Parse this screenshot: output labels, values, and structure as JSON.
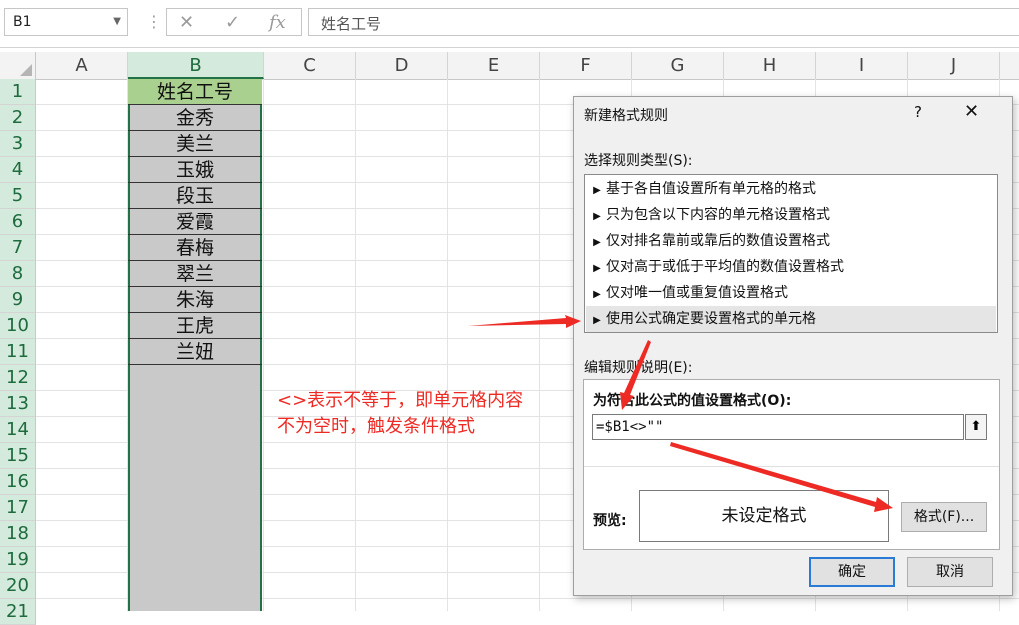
{
  "formula_bar": {
    "name_box": "B1",
    "cancel_icon": "✕",
    "enter_icon": "✓",
    "fx_icon": "fx",
    "content": "姓名工号"
  },
  "columns": [
    "A",
    "B",
    "C",
    "D",
    "E",
    "F",
    "G",
    "H",
    "I",
    "J"
  ],
  "rows": [
    "1",
    "2",
    "3",
    "4",
    "5",
    "6",
    "7",
    "8",
    "9",
    "10",
    "11",
    "12",
    "13",
    "14",
    "15",
    "16",
    "17",
    "18",
    "19",
    "20",
    "21"
  ],
  "cells_B": [
    "姓名工号",
    "金秀",
    "美兰",
    "玉娥",
    "段玉",
    "爱霞",
    "春梅",
    "翠兰",
    "朱海",
    "王虎",
    "兰妞"
  ],
  "annotation": {
    "line1": "<>表示不等于，即单元格内容",
    "line2": "不为空时，触发条件格式"
  },
  "dialog": {
    "title": "新建格式规则",
    "help": "?",
    "close": "✕",
    "rule_type_label": "选择规则类型(S):",
    "rule_types": [
      "基于各自值设置所有单元格的格式",
      "只为包含以下内容的单元格设置格式",
      "仅对排名靠前或靠后的数值设置格式",
      "仅对高于或低于平均值的数值设置格式",
      "仅对唯一值或重复值设置格式",
      "使用公式确定要设置格式的单元格"
    ],
    "selected_rule_index": 5,
    "desc_label": "编辑规则说明(E):",
    "formula_label": "为符合此公式的值设置格式(O):",
    "formula_value": "=$B1<>\"\"",
    "collapse_icon": "⬆",
    "preview_label": "预览:",
    "preview_text": "未设定格式",
    "format_button": "格式(F)...",
    "ok_button": "确定",
    "cancel_button": "取消"
  },
  "colors": {
    "header_fill": "#a9d08e",
    "column_fill": "#c9c9c9",
    "selection_green": "#217346",
    "annotation_red": "#ee2a24"
  }
}
